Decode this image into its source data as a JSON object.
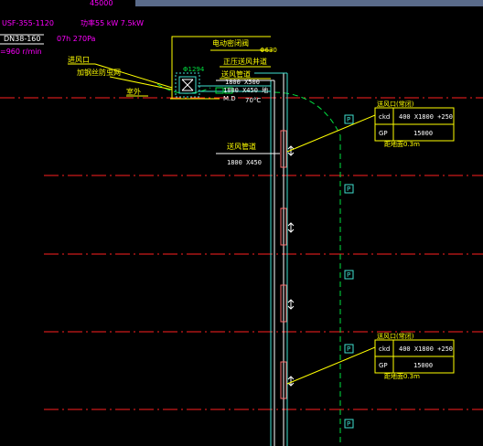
{
  "colors": {
    "background": "#000000",
    "magenta": "#ff00ff",
    "yellow": "#ffff00",
    "white": "#ffffff",
    "red": "#ff2020",
    "green": "#00e040",
    "cyan": "#40e0d0",
    "topbar": "#5a6b8a"
  },
  "top_left": {
    "label_45000": "45000",
    "fan_model": "USF-355-1120",
    "fan_power": "功率55 kW  7.5kW",
    "fan_flow": "DN38-160",
    "fan_pressure": "07h 270Pa",
    "fan_speed": "=960 r/min"
  },
  "annotations": {
    "air_inlet": "进风口",
    "rain_screen": "加钢丝防虫网",
    "outdoor": "室外",
    "elec_valve": "电动密闭阀",
    "valve_size": "Φ630",
    "positive_shaft": "正压送风井道",
    "supply_pipe": "送风管道",
    "duct_size_top": "1800 X500",
    "duct_size_2": "1800 X450 地",
    "md_label": "M.D",
    "note_70": "70°C",
    "phi_label": "Φ1294",
    "supply_duct_label": "送风管道",
    "supply_duct_size": "1800 X450"
  },
  "outlet_boxes": [
    {
      "title": "送风口(常闭)",
      "rows": [
        {
          "key": "ckd",
          "value": "400 X1800 +250"
        },
        {
          "key": "GP",
          "value": "15000"
        }
      ],
      "note": "距地面0.3m"
    },
    {
      "title": "送风口(常闭)",
      "rows": [
        {
          "key": "ckd",
          "value": "400 X1800 +250"
        },
        {
          "key": "GP",
          "value": "15000"
        }
      ],
      "note": "距地面0.3m"
    }
  ],
  "p_marker_label": "P"
}
